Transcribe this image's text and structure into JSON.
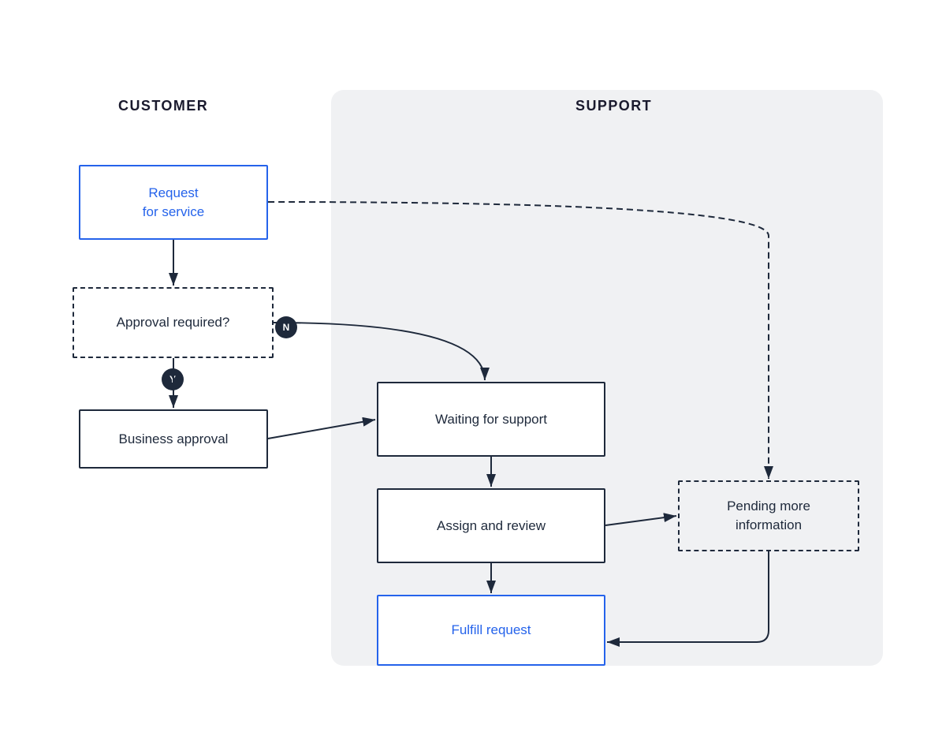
{
  "diagram": {
    "customer_header": "CUSTOMER",
    "support_header": "SUPPORT",
    "boxes": {
      "request_service": "Request\nfor service",
      "approval_required": "Approval required?",
      "business_approval": "Business approval",
      "waiting_for_support": "Waiting for support",
      "assign_and_review": "Assign and review",
      "fulfill_request": "Fulfill request",
      "pending_more_info": "Pending more\ninformation"
    },
    "badges": {
      "n": "N",
      "y": "Y"
    }
  },
  "colors": {
    "blue": "#2563eb",
    "dark": "#1e293b",
    "panel_bg": "#f0f1f3"
  }
}
